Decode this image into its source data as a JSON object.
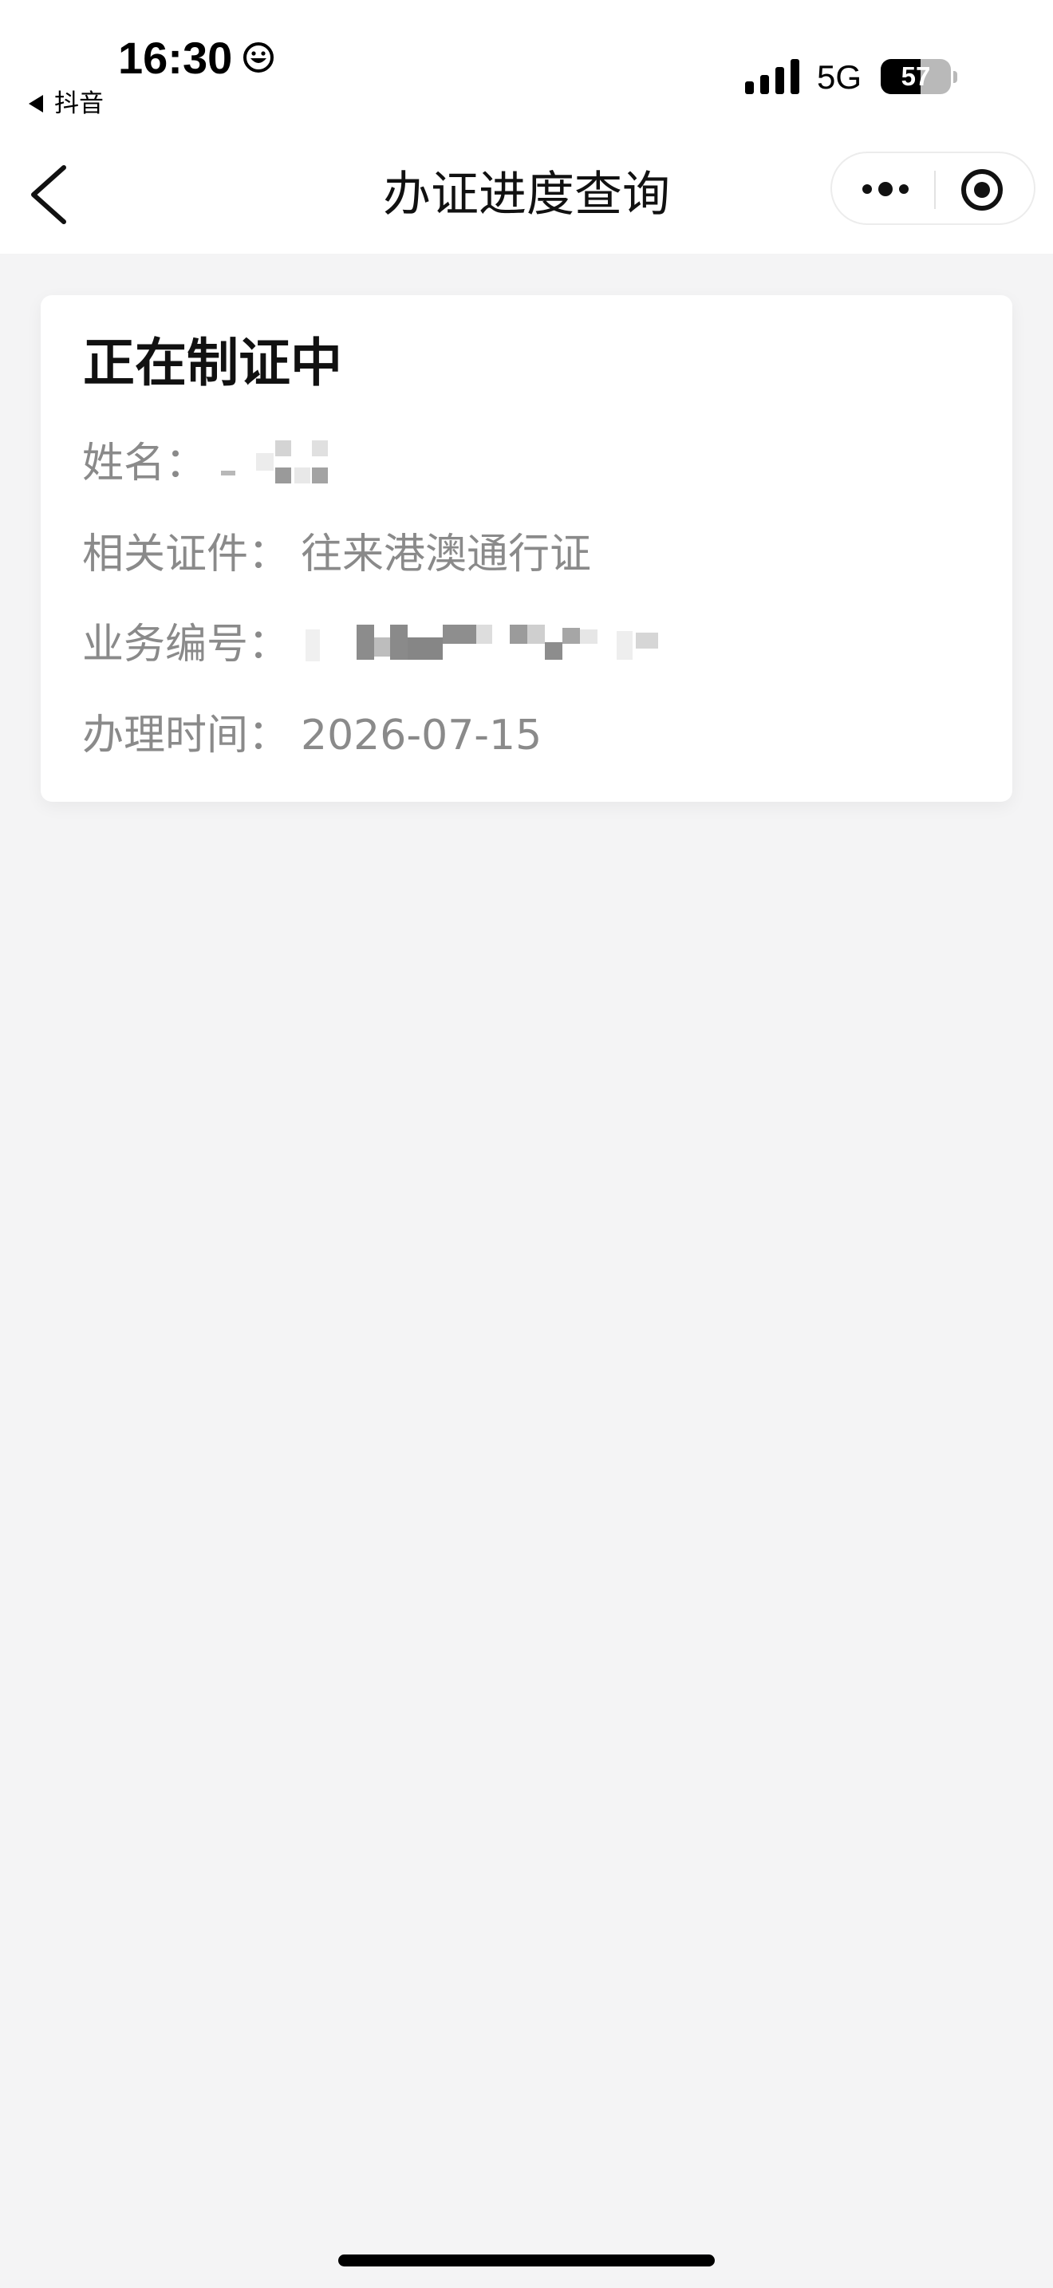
{
  "status_bar": {
    "time": "16:30",
    "back_app": "抖音",
    "network": "5G",
    "battery_percent": "57",
    "battery_level": 0.57
  },
  "nav": {
    "title": "办证进度查询"
  },
  "card": {
    "status": "正在制证中",
    "fields": [
      {
        "label": "姓名：",
        "value": ""
      },
      {
        "label": "相关证件：",
        "value": "往来港澳通行证"
      },
      {
        "label": "业务编号：",
        "value": ""
      },
      {
        "label": "办理时间：",
        "value": "2026-07-15"
      }
    ]
  },
  "icons": {
    "back": "chevron-left-icon",
    "more": "more-dots-icon",
    "close": "target-circle-icon",
    "smiley": "smiley-icon",
    "signal": "signal-bars-icon"
  },
  "colors": {
    "page_bg": "#f4f4f5",
    "card_bg": "#ffffff",
    "label_gray": "#8a8a8a",
    "title_black": "#111111"
  }
}
